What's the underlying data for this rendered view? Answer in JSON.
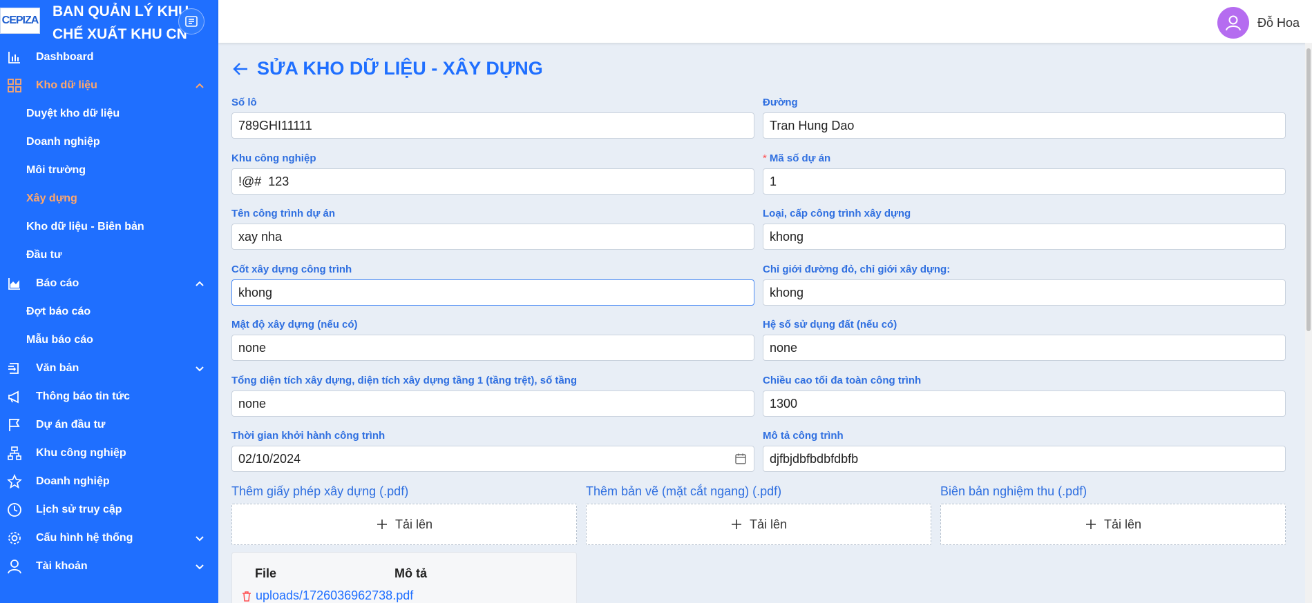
{
  "brand": {
    "logo_text": "CEPIZA",
    "title_line1": "BAN QUẢN LÝ KHU",
    "title_line2": "CHẾ XUẤT KHU CN"
  },
  "user": {
    "name": "Đỗ Hoa"
  },
  "sidebar": {
    "items": [
      {
        "label": "Dashboard",
        "icon": "bar-chart-icon"
      },
      {
        "label": "Kho dữ liệu",
        "icon": "grid-icon",
        "expanded": true,
        "children": [
          "Duyệt kho dữ liệu",
          "Doanh nghiệp",
          "Môi trường",
          "Xây dựng",
          "Kho dữ liệu - Biên bản",
          "Đầu tư"
        ]
      },
      {
        "label": "Báo cáo",
        "icon": "area-chart-icon",
        "expanded": true,
        "children": [
          "Đợt báo cáo",
          "Mẫu báo cáo"
        ]
      },
      {
        "label": "Văn bản",
        "icon": "document-icon"
      },
      {
        "label": "Thông báo tin tức",
        "icon": "megaphone-icon"
      },
      {
        "label": "Dự án đầu tư",
        "icon": "flag-icon"
      },
      {
        "label": "Khu công nghiệp",
        "icon": "org-chart-icon"
      },
      {
        "label": "Doanh nghiệp",
        "icon": "star-icon"
      },
      {
        "label": "Lịch sử truy cập",
        "icon": "clock-icon"
      },
      {
        "label": "Cấu hình hệ thống",
        "icon": "gear-icon"
      },
      {
        "label": "Tài khoản",
        "icon": "user-icon"
      }
    ],
    "active_child": "Xây dựng",
    "active_color": "#ffa76b"
  },
  "page": {
    "title": "SỬA KHO DỮ LIỆU - XÂY DỰNG"
  },
  "form": {
    "so_lo": {
      "label": "Số lô",
      "value": "789GHI11111"
    },
    "duong": {
      "label": "Đường",
      "value": "Tran Hung Dao"
    },
    "khu_cong_nghiep": {
      "label": "Khu công nghiệp",
      "value": "!@#  123"
    },
    "ma_so_du_an": {
      "label": "Mã số dự án",
      "required_mark": "*",
      "value": "1"
    },
    "ten_cong_trinh": {
      "label": "Tên công trình dự án",
      "value": "xay nha"
    },
    "loai_cap": {
      "label": "Loại, cấp công trình xây dựng",
      "value": "khong"
    },
    "cot_xay_dung": {
      "label": "Cốt xây dựng công trình",
      "value": "khong"
    },
    "chi_gioi": {
      "label": "Chỉ giới đường đỏ, chỉ giới xây dựng:",
      "value": "khong"
    },
    "mat_do": {
      "label": "Mật độ xây dựng (nếu có)",
      "value": "none"
    },
    "he_so": {
      "label": "Hệ số sử dụng đất (nếu có)",
      "value": "none"
    },
    "tong_dien_tich": {
      "label": "Tổng diện tích xây dựng, diện tích xây dựng tầng 1 (tầng trệt), số tầng",
      "value": "none"
    },
    "chieu_cao": {
      "label": "Chiều cao tối đa toàn công trình",
      "value": "1300"
    },
    "thoi_gian": {
      "label": "Thời gian khởi hành công trình",
      "value": "02/10/2024"
    },
    "mo_ta": {
      "label": "Mô tả công trình",
      "value": "djfbjdbfbdbfdbfb"
    }
  },
  "uploads": [
    {
      "label": "Thêm giấy phép xây dựng (.pdf)",
      "button": "Tải lên"
    },
    {
      "label": "Thêm bản vẽ (mặt cắt ngang) (.pdf)",
      "button": "Tải lên"
    },
    {
      "label": "Biên bản nghiệm thu (.pdf)",
      "button": "Tải lên"
    }
  ],
  "file_table": {
    "col_file": "File",
    "col_desc": "Mô tả",
    "rows": [
      {
        "file": "uploads/1726036962738.pdf"
      }
    ]
  },
  "colors": {
    "sidebar_bg": "#1f6fff",
    "accent": "#1f6fff",
    "label": "#2f6fe0",
    "delete": "#ff4d4f"
  }
}
